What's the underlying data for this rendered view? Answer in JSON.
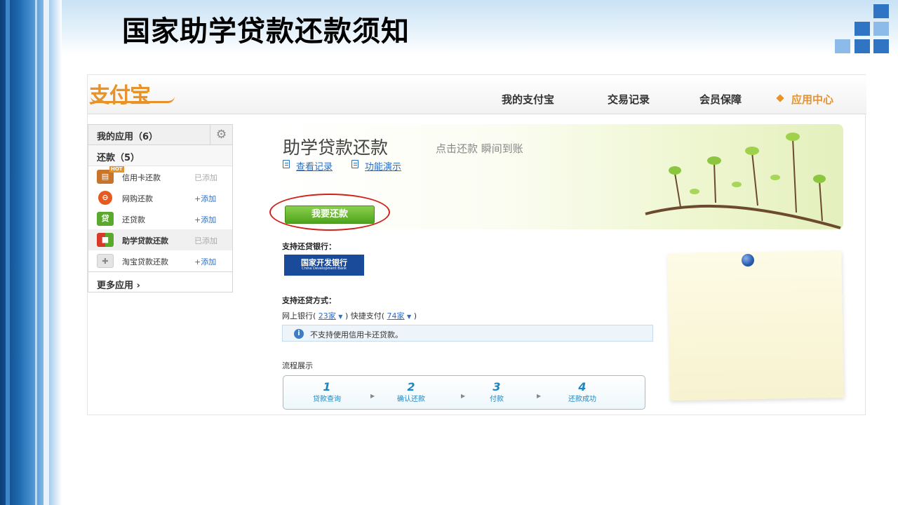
{
  "slide": {
    "title": "国家助学贷款还款须知",
    "colors": {
      "blue_accent": "#2f75c4",
      "blue_light": "#8dbbe9"
    }
  },
  "header": {
    "logo": "支付宝",
    "nav": [
      "我的支付宝",
      "交易记录",
      "会员保障",
      "应用中心"
    ]
  },
  "sidebar": {
    "my_apps": "我的应用（6）",
    "section": "还款（5）",
    "items": [
      {
        "label": "信用卡还款",
        "action": "已添加",
        "icon": "credit-card-icon",
        "badge": "HOT"
      },
      {
        "label": "网购还款",
        "action": "+添加",
        "icon": "shopping-icon"
      },
      {
        "label": "还贷款",
        "action": "+添加",
        "icon": "loan-icon",
        "glyph": "贷"
      },
      {
        "label": "助学贷款还款",
        "action": "已添加",
        "icon": "student-loan-icon"
      },
      {
        "label": "淘宝贷款还款",
        "action": "+添加",
        "icon": "puzzle-icon"
      }
    ],
    "more": "更多应用 ›"
  },
  "banner": {
    "title": "助学贷款还款",
    "subtitle": "点击还款 瞬间到账",
    "links": [
      "查看记录",
      "功能演示"
    ]
  },
  "main": {
    "pay_button": "我要还款",
    "banks_label": "支持还贷银行：",
    "bank": {
      "name_cn": "国家开发银行",
      "name_en": "China Development Bank"
    },
    "methods_label": "支持还贷方式：",
    "methods": {
      "prefix1": "网上银行(",
      "count1": "23家",
      "mid": ")  快捷支付(",
      "count2": "74家",
      "suffix": ")"
    },
    "notice": "不支持使用信用卡还贷款。",
    "flow_label": "流程展示",
    "steps": [
      {
        "num": "1",
        "label": "贷款查询"
      },
      {
        "num": "2",
        "label": "确认还款"
      },
      {
        "num": "3",
        "label": "付款"
      },
      {
        "num": "4",
        "label": "还款成功"
      }
    ]
  }
}
